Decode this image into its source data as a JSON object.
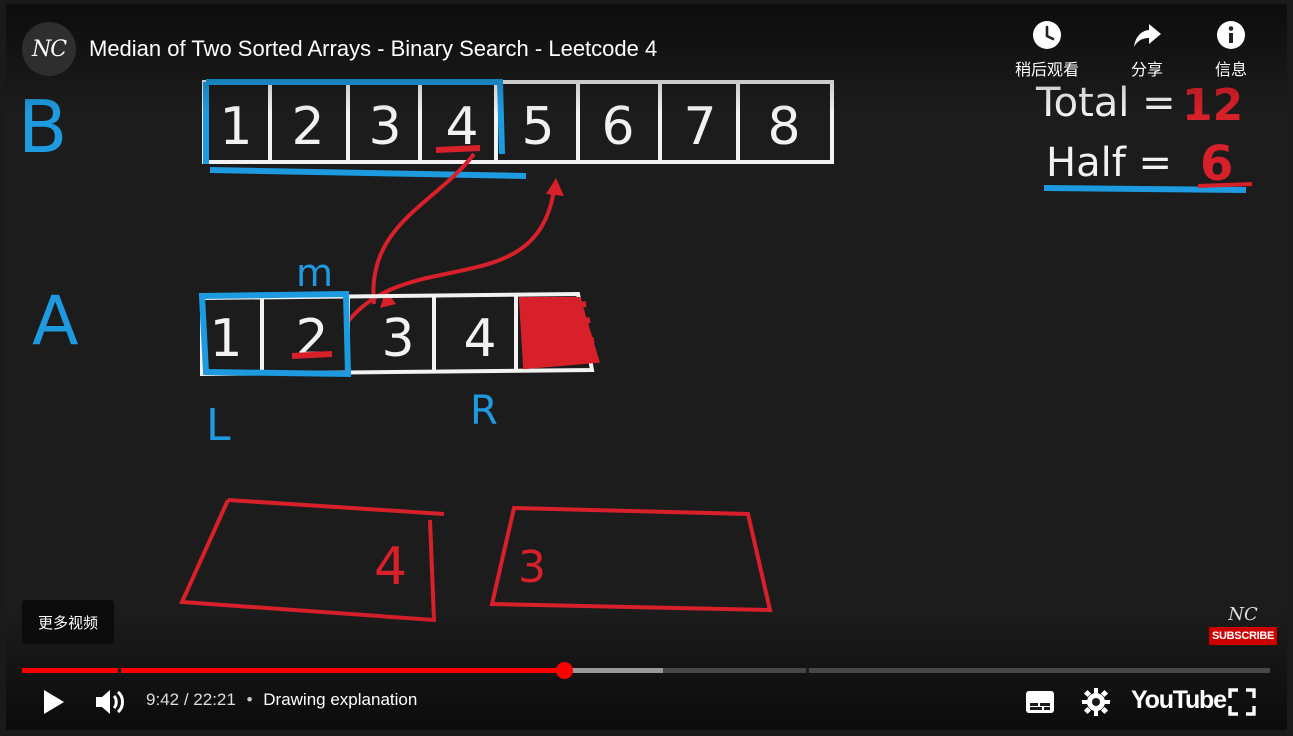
{
  "header": {
    "channel_initials": "NC",
    "title": "Median of Two Sorted Arrays - Binary Search - Leetcode 4",
    "actions": [
      {
        "label": "稍后观看",
        "icon": "clock-icon"
      },
      {
        "label": "分享",
        "icon": "share-arrow-icon"
      },
      {
        "label": "信息",
        "icon": "info-icon"
      }
    ]
  },
  "board": {
    "label_b": "B",
    "label_a": "A",
    "array_b": [
      "1",
      "2",
      "3",
      "4",
      "5",
      "6",
      "7",
      "8"
    ],
    "array_a": [
      "1",
      "2",
      "3",
      "4"
    ],
    "mid_marker": "m",
    "left_marker": "L",
    "right_marker": "R",
    "total_label": "Total =",
    "total_value": "12",
    "half_label": "Half =",
    "half_value": "6",
    "left_partition_value": "4",
    "right_partition_value": "3",
    "colors": {
      "white": "#f2f2f2",
      "blue": "#1e9be0",
      "red": "#d8202a"
    }
  },
  "overlay": {
    "more_videos": "更多视频",
    "watermark_initials": "NC",
    "subscribe": "SUBSCRIBE"
  },
  "controls": {
    "current_time": "9:42",
    "duration": "22:21",
    "separator": "/",
    "dot": "•",
    "chapter": "Drawing explanation",
    "logo": "YouTube",
    "progress_played_fraction": 0.434,
    "progress_buffered_fraction": 0.514,
    "accent": "#ff0000"
  }
}
